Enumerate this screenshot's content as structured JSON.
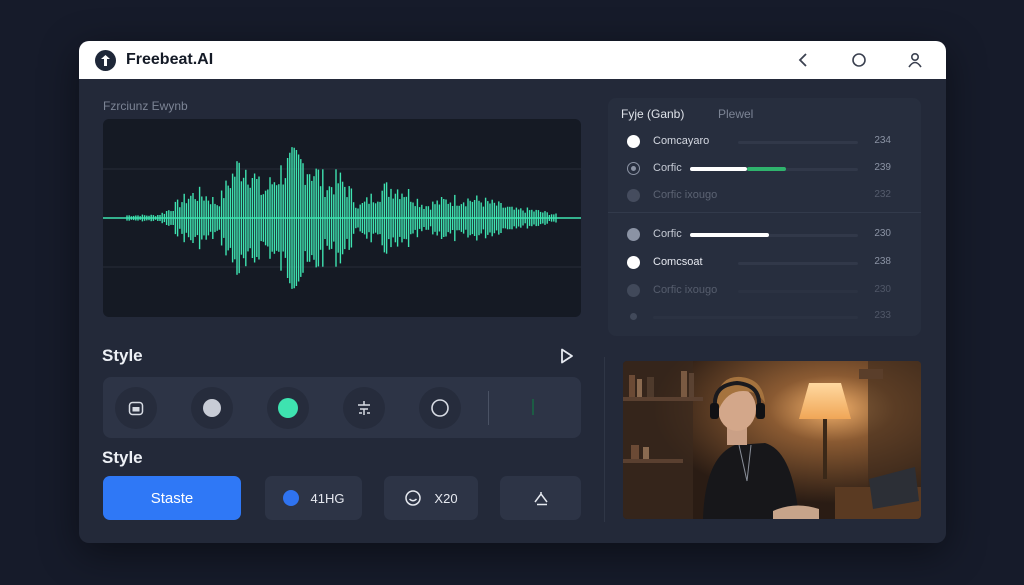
{
  "app": {
    "title": "Freebeat.AI"
  },
  "titlebar_icons": [
    "back-chevron-icon",
    "circle-icon",
    "user-icon"
  ],
  "waveform": {
    "label": "Fzrciunz Ewynb",
    "color": "#3ee3b0"
  },
  "style_sections": [
    {
      "title": "Style"
    },
    {
      "title": "Style"
    }
  ],
  "style_options": [
    {
      "icon": "box-icon",
      "selected": false
    },
    {
      "icon": "gray-dot-icon",
      "selected": false
    },
    {
      "icon": "green-dot-icon",
      "selected": true
    },
    {
      "icon": "tune-icon",
      "selected": false
    },
    {
      "icon": "ring-icon",
      "selected": false
    }
  ],
  "actions": {
    "primary_label": "Staste",
    "blue_label": "41HG",
    "smile_label": "X20"
  },
  "list": {
    "header_left": "Fyje (Ganb)",
    "header_right": "Plewel",
    "rows": [
      {
        "label": "Comcayaro",
        "value": "234",
        "radio": "filled",
        "progress": null
      },
      {
        "label": "Corfic",
        "value": "239",
        "radio": "outline",
        "progress": 0.34,
        "accent": 0.23
      },
      {
        "label": "Corfic ixougo",
        "value": "232",
        "radio": "dim",
        "progress": null
      },
      {
        "label": "Corfic",
        "value": "230",
        "radio": "gray",
        "progress": 0.47
      },
      {
        "label": "Comcsoat",
        "value": "238",
        "radio": "filled",
        "progress": null
      },
      {
        "label": "Corfic ixougo",
        "value": "230",
        "radio": "dim",
        "progress": null
      },
      {
        "label": "",
        "value": "233",
        "radio": "small",
        "progress": null
      }
    ]
  },
  "colors": {
    "accent_green": "#3ee3b0",
    "primary_blue": "#2f78f6",
    "panel": "#232939",
    "background": "#161b2a"
  }
}
